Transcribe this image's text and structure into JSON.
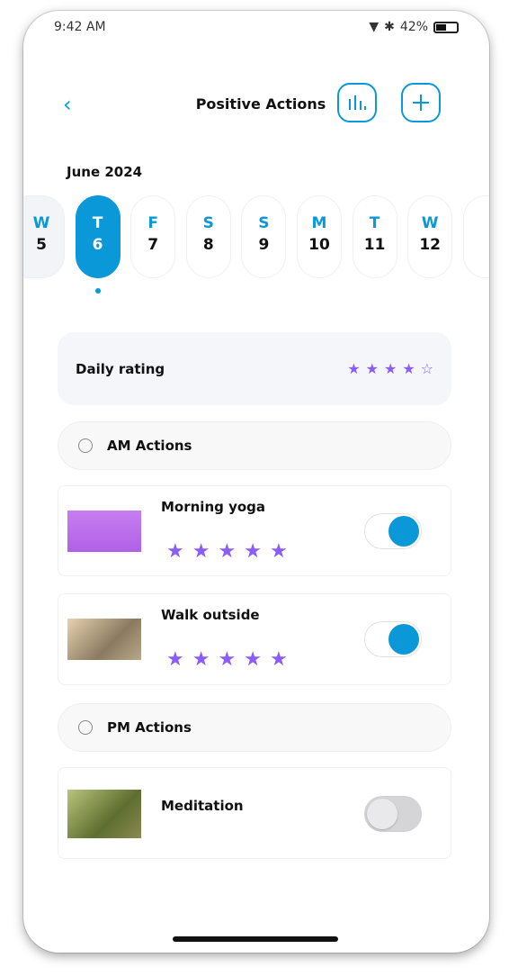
{
  "status": {
    "time": "9:42 AM",
    "battery": "42%",
    "icons": [
      "wifi-icon",
      "bluetooth-icon",
      "battery-icon"
    ]
  },
  "header": {
    "title": "Positive Actions",
    "back_icon": "chevron-left-icon",
    "stats_icon": "bar-chart-icon",
    "add_icon": "plus-icon"
  },
  "calendar": {
    "month": "June 2024",
    "selected_index": 1,
    "days": [
      {
        "l": "W",
        "n": "5"
      },
      {
        "l": "T",
        "n": "6"
      },
      {
        "l": "F",
        "n": "7"
      },
      {
        "l": "S",
        "n": "8"
      },
      {
        "l": "S",
        "n": "9"
      },
      {
        "l": "M",
        "n": "10"
      },
      {
        "l": "T",
        "n": "11"
      },
      {
        "l": "W",
        "n": "12"
      }
    ]
  },
  "daily_rating": {
    "label": "Daily rating",
    "value": 4,
    "max": 5
  },
  "sections": {
    "am": "AM Actions",
    "pm": "PM Actions"
  },
  "actions": [
    {
      "name": "Morning yoga",
      "rating": 5,
      "enabled": true
    },
    {
      "name": "Walk outside",
      "rating": 5,
      "enabled": true
    },
    {
      "name": "Meditation",
      "enabled": false
    }
  ],
  "colors": {
    "accent": "#0a98d8",
    "star": "#8b5cf6"
  }
}
